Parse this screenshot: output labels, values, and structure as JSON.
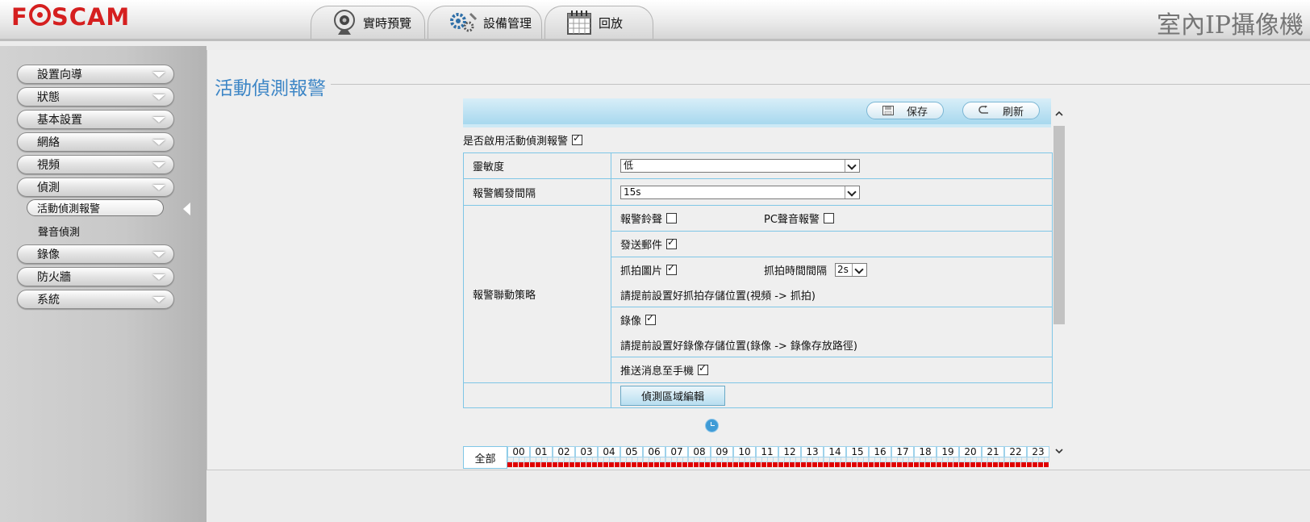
{
  "header": {
    "logo": "FOSCAM",
    "tabs": [
      {
        "label": "實時預覽",
        "icon": "webcam-icon"
      },
      {
        "label": "設備管理",
        "icon": "gears-icon"
      },
      {
        "label": "回放",
        "icon": "calendar-icon"
      }
    ],
    "product_title": "室內IP攝像機"
  },
  "sidebar": {
    "items": [
      {
        "label": "設置向導"
      },
      {
        "label": "狀態"
      },
      {
        "label": "基本設置"
      },
      {
        "label": "網絡"
      },
      {
        "label": "視頻"
      },
      {
        "label": "偵測"
      },
      {
        "label": "錄像"
      },
      {
        "label": "防火牆"
      },
      {
        "label": "系統"
      }
    ],
    "sub_items": [
      {
        "label": "活動偵測報警",
        "active": true
      },
      {
        "label": "聲音偵測",
        "active": false
      }
    ]
  },
  "page": {
    "title": "活動偵測報警",
    "toolbar": {
      "save_label": "保存",
      "refresh_label": "刷新"
    },
    "enable_label": "是否啟用活動偵測報警",
    "enable_checked": true,
    "sensitivity": {
      "label": "靈敏度",
      "value": "低"
    },
    "trigger_interval": {
      "label": "報警觸發間隔",
      "value": "15s"
    },
    "linkage": {
      "label": "報警聯動策略",
      "alarm_bell": {
        "label": "報警鈴聲",
        "checked": false
      },
      "pc_sound": {
        "label": "PC聲音報警",
        "checked": false
      },
      "send_email": {
        "label": "發送郵件",
        "checked": true
      },
      "snapshot": {
        "label": "抓拍圖片",
        "checked": true
      },
      "snapshot_interval": {
        "label": "抓拍時間間隔",
        "value": "2s"
      },
      "snapshot_note": "請提前設置好抓拍存儲位置(視頻 -> 抓拍)",
      "record": {
        "label": "錄像",
        "checked": true
      },
      "record_note": "請提前設置好錄像存儲位置(錄像 -> 錄像存放路徑)",
      "push": {
        "label": "推送消息至手機",
        "checked": true
      }
    },
    "region_button": "偵測區域編輯",
    "schedule": {
      "all_label": "全部",
      "hours": [
        "00",
        "01",
        "02",
        "03",
        "04",
        "05",
        "06",
        "07",
        "08",
        "09",
        "10",
        "11",
        "12",
        "13",
        "14",
        "15",
        "16",
        "17",
        "18",
        "19",
        "20",
        "21",
        "22",
        "23"
      ],
      "color": "#e00000"
    }
  }
}
